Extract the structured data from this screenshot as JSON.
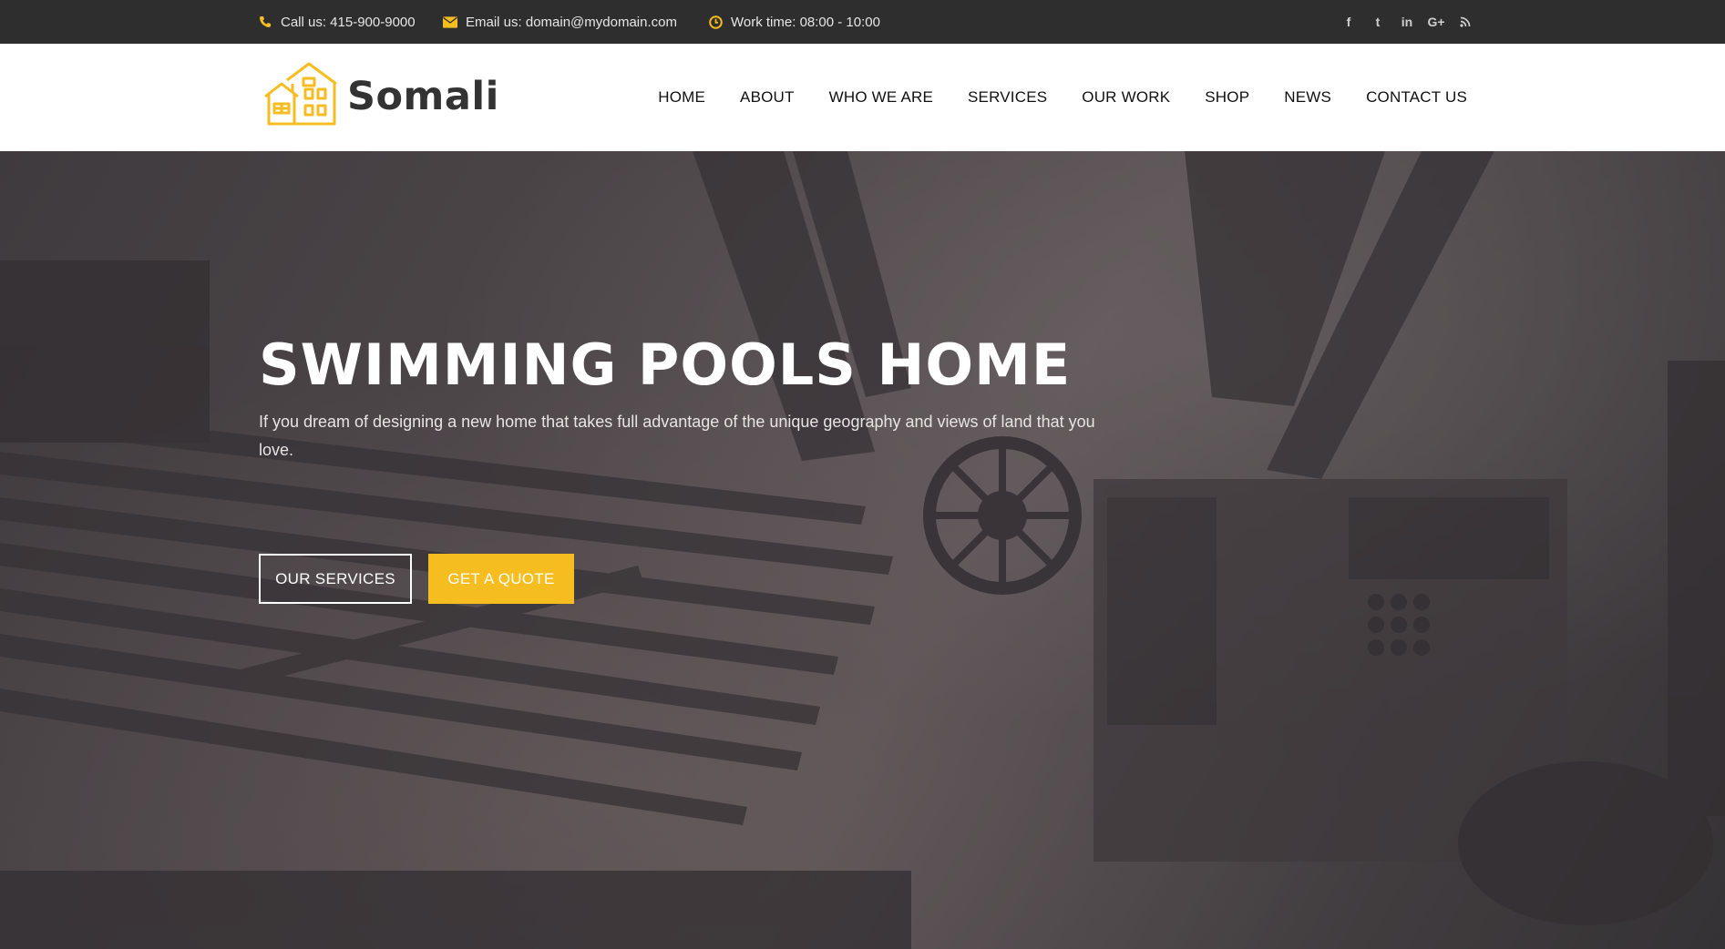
{
  "topbar": {
    "phone": "Call us: 415-900-9000",
    "email": "Email us: domain@mydomain.com",
    "hours": "Work time: 08:00 - 10:00",
    "social": [
      "f",
      "t",
      "in",
      "G+",
      "rss"
    ]
  },
  "brand": {
    "name": "Somali"
  },
  "nav": {
    "items": [
      "HOME",
      "ABOUT",
      "WHO WE ARE",
      "SERVICES",
      "OUR WORK",
      "SHOP",
      "NEWS",
      "CONTACT US"
    ]
  },
  "hero": {
    "title": "SWIMMING POOLS HOME",
    "subtitle": "If you dream of designing a new home that takes full advantage of the unique geography and views of land that you love.",
    "primary_button": "OUR SERVICES",
    "secondary_button": "GET A QUOTE"
  },
  "colors": {
    "accent": "#f5bd1f",
    "topbar_bg": "#2e2e2e",
    "header_bg": "#ffffff"
  },
  "icons": {
    "phone": "phone-icon",
    "email": "envelope-icon",
    "hours": "clock-icon",
    "logo": "house-icon"
  }
}
